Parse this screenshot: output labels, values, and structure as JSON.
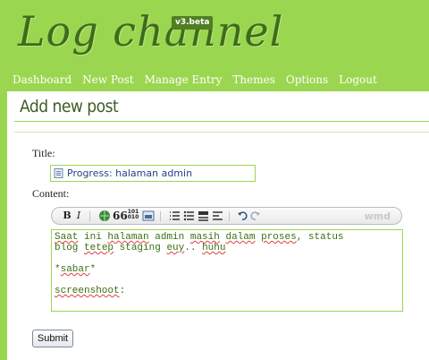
{
  "header": {
    "logo": "Log channel",
    "version": "v3.beta"
  },
  "nav": [
    "Dashboard",
    "New Post",
    "Manage Entry",
    "Themes",
    "Options",
    "Logout"
  ],
  "page": {
    "title": "Add new post"
  },
  "form": {
    "title_label": "Title:",
    "title_value": "Progress: halaman admin",
    "content_label": "Content:",
    "toolbar": {
      "bold": "B",
      "italic": "I",
      "quote": "66",
      "code": "101\n010",
      "brand": "wmd"
    },
    "content_lines": [
      "Saat ini halaman admin masih dalam proses, status",
      "blog tetep staging euy.. huhu",
      "",
      "*sabar*",
      "",
      "screenshoot:"
    ],
    "submit_label": "Submit"
  },
  "colors": {
    "accent": "#9bd650",
    "header_text": "#3f6b1c",
    "content_text": "#3a6e12"
  }
}
